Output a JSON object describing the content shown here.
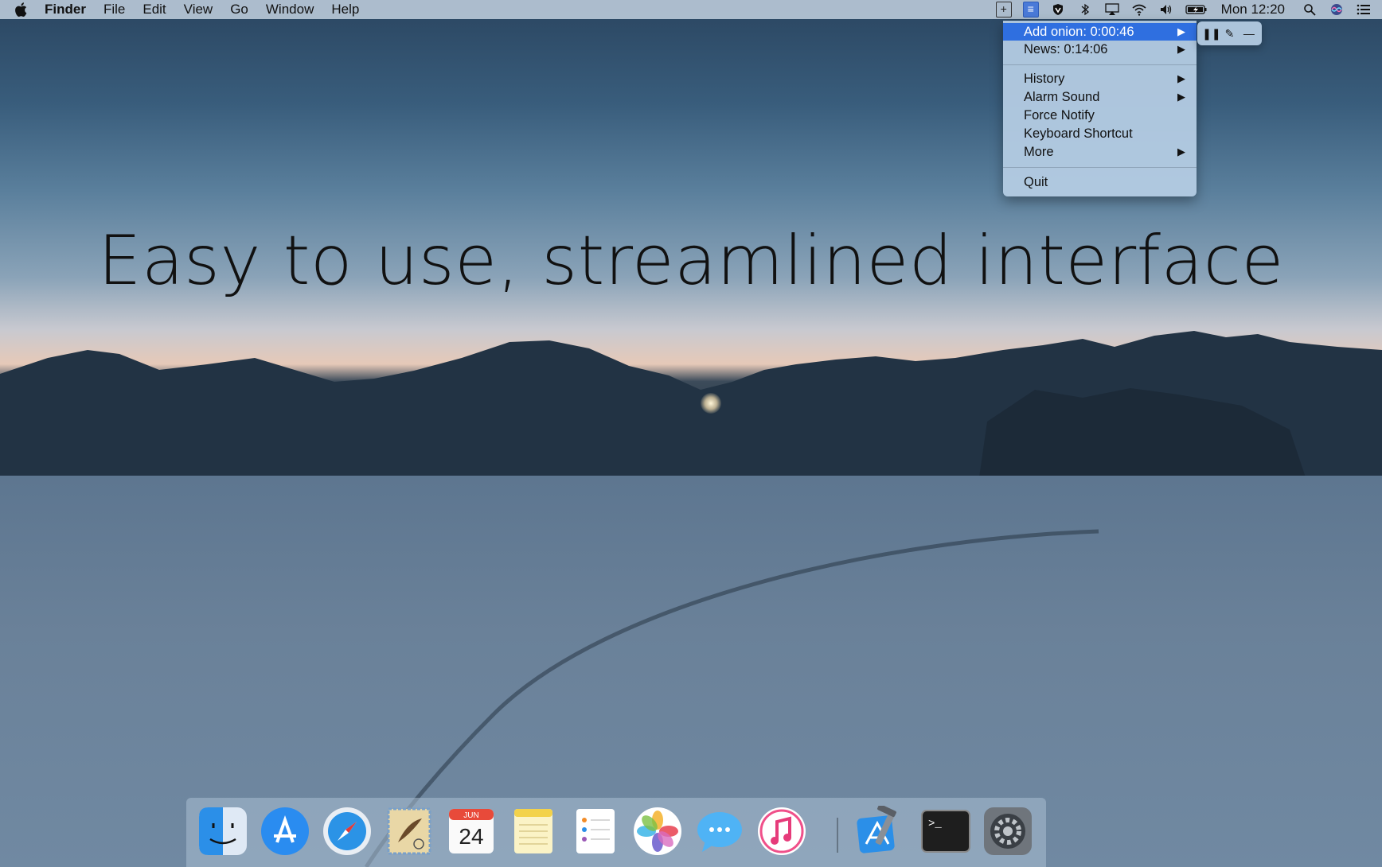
{
  "menubar": {
    "app_name": "Finder",
    "menus": [
      "File",
      "Edit",
      "View",
      "Go",
      "Window",
      "Help"
    ],
    "clock": "Mon 12:20",
    "status_icons": [
      "plus-icon",
      "timer-list-icon",
      "shield-icon",
      "bluetooth-icon",
      "airplay-icon",
      "wifi-icon",
      "volume-icon",
      "battery-icon",
      "search-icon",
      "siri-icon",
      "notification-list-icon"
    ]
  },
  "menu": {
    "items": [
      {
        "label": "Add onion: 0:00:46",
        "has_submenu": true,
        "highlighted": true
      },
      {
        "label": "News: 0:14:06",
        "has_submenu": true
      },
      {
        "label": "History",
        "has_submenu": true
      },
      {
        "label": "Alarm Sound",
        "has_submenu": true
      },
      {
        "label": "Force Notify",
        "has_submenu": false
      },
      {
        "label": "Keyboard Shortcut",
        "has_submenu": false
      },
      {
        "label": "More",
        "has_submenu": true
      },
      {
        "label": "Quit",
        "has_submenu": false
      }
    ],
    "submenu_arrow": "▶"
  },
  "timer_controls": {
    "pause": "❚❚",
    "edit": "✎",
    "remove": "—"
  },
  "headline": "Easy to use, streamlined interface",
  "dock": {
    "apps": [
      "Finder",
      "App Store",
      "Safari",
      "Mail",
      "Calendar",
      "Notes",
      "Reminders",
      "Photos",
      "Messages",
      "iTunes",
      "Xcode",
      "Terminal",
      "System Preferences"
    ],
    "calendar_month": "JUN",
    "calendar_day": "24",
    "terminal_prompt": ">_"
  },
  "colors": {
    "menu_highlight": "#2f6fe0",
    "menubar_bg": "#becdda"
  }
}
